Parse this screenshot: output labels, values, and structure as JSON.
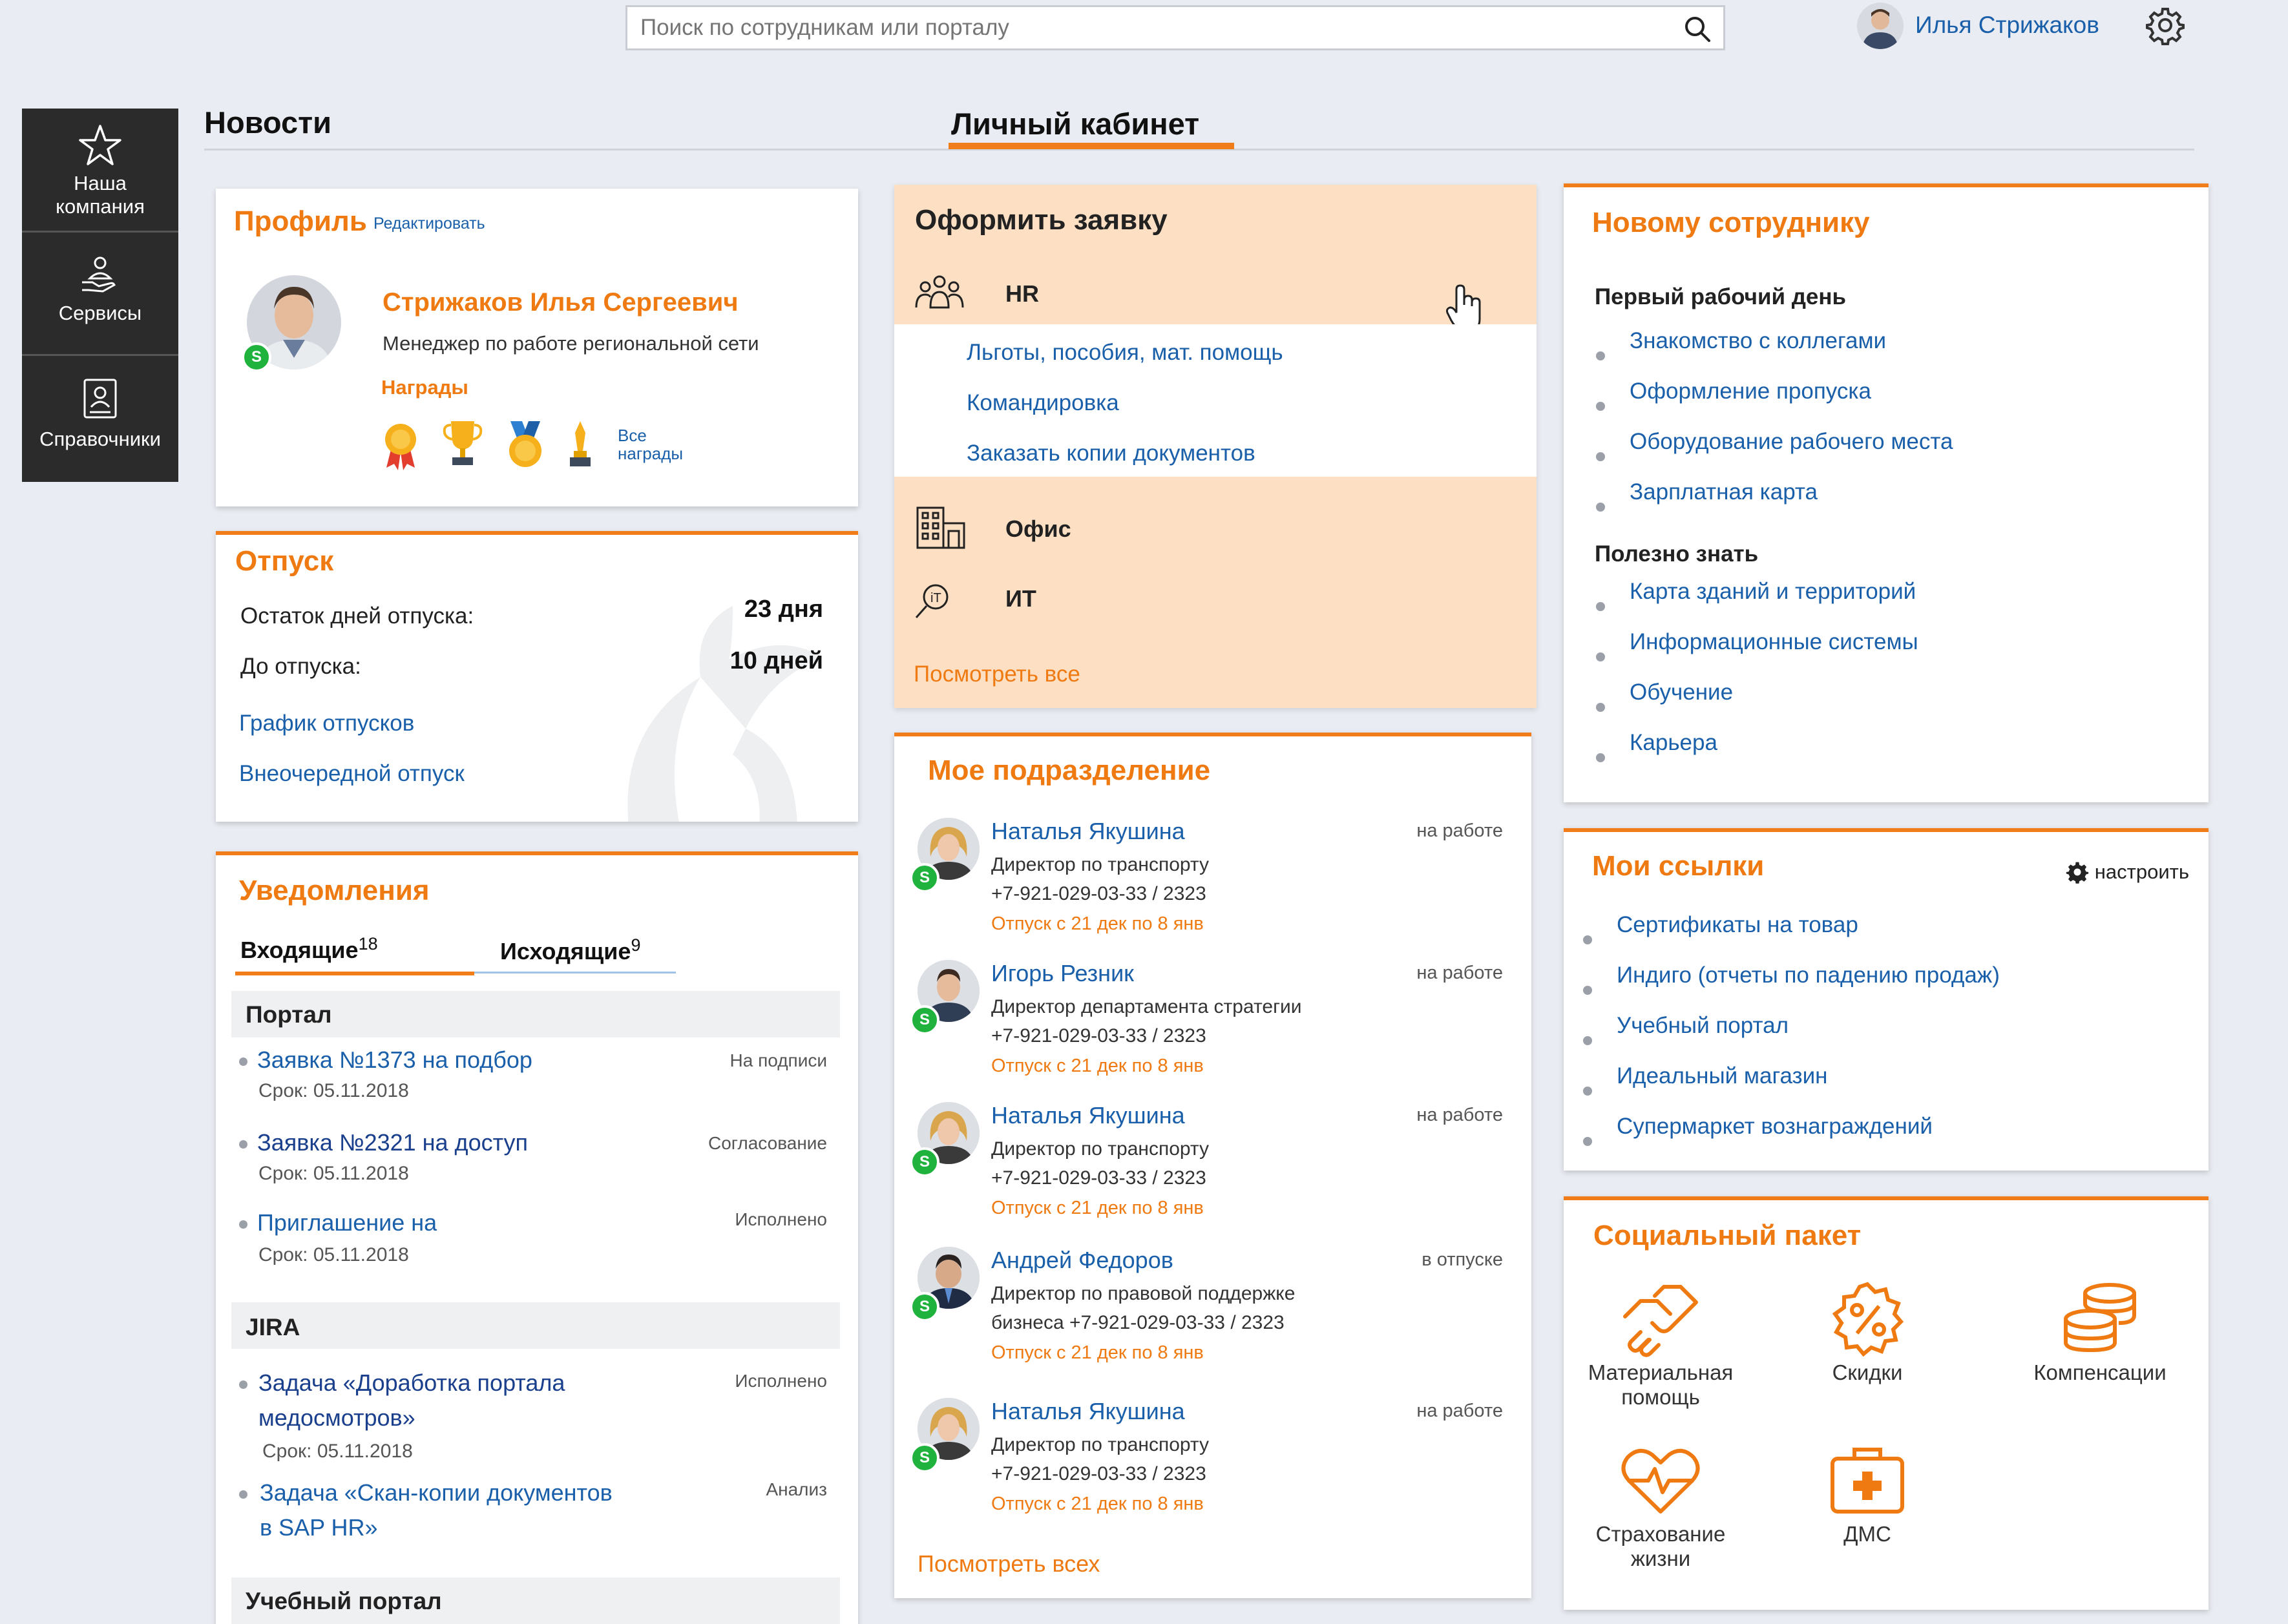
{
  "header": {
    "search_placeholder": "Поиск по сотрудникам или порталу",
    "user_name": "Илья Стрижаков"
  },
  "left_nav": {
    "items": [
      {
        "label_line1": "Наша",
        "label_line2": "компания",
        "icon": "star-icon"
      },
      {
        "label_line1": "Сервисы",
        "label_line2": "",
        "icon": "services-icon"
      },
      {
        "label_line1": "Справочники",
        "label_line2": "",
        "icon": "directory-icon"
      }
    ]
  },
  "tabs": {
    "news": "Новости",
    "cabinet": "Личный кабинет"
  },
  "profile": {
    "title": "Профиль",
    "edit": "Редактировать",
    "name": "Стрижаков Илья Сергеевич",
    "position": "Менеджер по работе региональной сети",
    "awards_title": "Награды",
    "all_awards_line1": "Все",
    "all_awards_line2": "награды"
  },
  "vacation": {
    "title": "Отпуск",
    "remaining_label": "Остаток дней отпуска:",
    "remaining_value": "23 дня",
    "until_label": "До отпуска:",
    "until_value": "10 дней",
    "link_schedule": "График отпусков",
    "link_extra": "Внеочередной отпуск"
  },
  "notifications": {
    "title": "Уведомления",
    "tab_in": "Входящие",
    "tab_in_count": "18",
    "tab_out": "Исходящие",
    "tab_out_count": "9",
    "groups": [
      {
        "name": "Портал",
        "items": [
          {
            "line1": "Заявка №1373 на подбор",
            "line2": "",
            "due": "Срок: 05.11.2018",
            "status": "На подписи"
          },
          {
            "line1": "Заявка №2321 на доступ",
            "line2": "",
            "due": "Срок: 05.11.2018",
            "status": "Согласование"
          },
          {
            "line1": "Приглашение на",
            "line2": "",
            "due": "Срок: 05.11.2018",
            "status": "Исполнено"
          }
        ]
      },
      {
        "name": "JIRA",
        "items": [
          {
            "line1": "Задача «Доработка портала",
            "line2": "медосмотров»",
            "due": "Срок: 05.11.2018",
            "status": "Исполнено"
          },
          {
            "line1": "Задача «Скан-копии документов",
            "line2": "в SAP HR»",
            "due": "",
            "status": "Анализ"
          }
        ]
      },
      {
        "name": "Учебный портал",
        "items": []
      }
    ]
  },
  "request": {
    "title": "Оформить заявку",
    "hr": "HR",
    "hr_links": [
      "Льготы, пособия, мат. помощь",
      "Командировка",
      "Заказать копии документов"
    ],
    "office": "Офис",
    "it": "ИТ",
    "view_all": "Посмотреть все"
  },
  "department": {
    "title": "Мое подразделение",
    "people": [
      {
        "name": "Наталья Якушина",
        "role_line1": "Директор по транспорту",
        "role_line2": "+7-921-029-03-33 / 2323",
        "vacation": "Отпуск с 21 дек по 8 янв",
        "status": "на работе",
        "photo": "female"
      },
      {
        "name": "Игорь Резник",
        "role_line1": "Директор департамента стратегии",
        "role_line2": "+7-921-029-03-33 / 2323",
        "vacation": "Отпуск с 21 дек по 8 янв",
        "status": "на работе",
        "photo": "male"
      },
      {
        "name": "Наталья Якушина",
        "role_line1": "Директор по транспорту",
        "role_line2": "+7-921-029-03-33 / 2323",
        "vacation": "Отпуск с 21 дек по 8 янв",
        "status": "на работе",
        "photo": "female"
      },
      {
        "name": "Андрей Федоров",
        "role_line1": "Директор по правовой поддержке",
        "role_line2": "бизнеса +7-921-029-03-33 / 2323",
        "vacation": "Отпуск с 21 дек по 8 янв",
        "status": "в отпуске",
        "photo": "male2"
      },
      {
        "name": "Наталья Якушина",
        "role_line1": "Директор по транспорту",
        "role_line2": "+7-921-029-03-33 / 2323",
        "vacation": "Отпуск с 21 дек по 8 янв",
        "status": "на работе",
        "photo": "female"
      }
    ],
    "view_all": "Посмотреть всех"
  },
  "newcomer": {
    "title": "Новому сотруднику",
    "section1": "Первый рабочий день",
    "links1": [
      "Знакомство с коллегами",
      "Оформление пропуска",
      "Оборудование рабочего места",
      "Зарплатная карта"
    ],
    "section2": "Полезно знать",
    "links2": [
      "Карта зданий и территорий",
      "Информационные системы",
      "Обучение",
      "Карьера"
    ]
  },
  "my_links": {
    "title": "Мои ссылки",
    "configure": "настроить",
    "links": [
      "Сертификаты на товар",
      "Индиго (отчеты по падению продаж)",
      "Учебный портал",
      "Идеальный магазин",
      "Супермаркет вознаграждений"
    ]
  },
  "social": {
    "title": "Социальный пакет",
    "items": [
      {
        "line1": "Материальная",
        "line2": "помощь",
        "icon": "handshake-icon"
      },
      {
        "line1": "Скидки",
        "line2": "",
        "icon": "discount-icon"
      },
      {
        "line1": "Компенсации",
        "line2": "",
        "icon": "coins-icon"
      },
      {
        "line1": "Страхование",
        "line2": "жизни",
        "icon": "heart-pulse-icon"
      },
      {
        "line1": "ДМС",
        "line2": "",
        "icon": "medkit-icon"
      }
    ]
  },
  "colors": {
    "accent": "#ef7a12",
    "link": "#1a5faa",
    "nav_bg": "#2b2b2b",
    "request_bg": "#fde0c4"
  }
}
